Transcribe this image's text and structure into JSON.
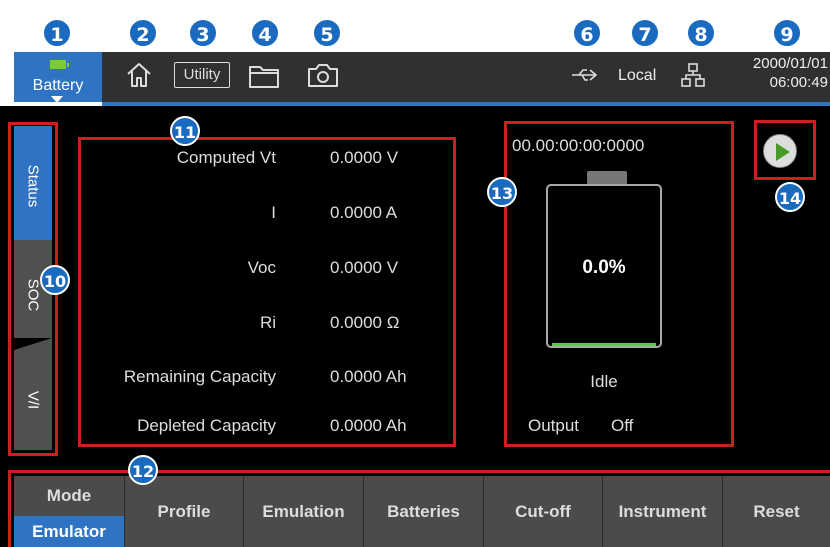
{
  "callouts": [
    "1",
    "2",
    "3",
    "4",
    "5",
    "6",
    "7",
    "8",
    "9",
    "10",
    "11",
    "12",
    "13",
    "14"
  ],
  "topbar": {
    "battery_tab_label": "Battery",
    "utility_label": "Utility",
    "local_label": "Local",
    "date": "2000/01/01",
    "time": "06:00:49",
    "icons": [
      "battery-level-icon",
      "home-icon",
      "folder-icon",
      "camera-icon",
      "usb-icon",
      "network-icon"
    ]
  },
  "sidebar": {
    "tabs": [
      {
        "label": "Status"
      },
      {
        "label": "SOC"
      },
      {
        "label": "V/I"
      }
    ]
  },
  "status": {
    "rows": [
      {
        "label": "Computed Vt",
        "value": "0.0000 V"
      },
      {
        "label": "I",
        "value": "0.0000 A"
      },
      {
        "label": "Voc",
        "value": "0.0000 V"
      },
      {
        "label": "Ri",
        "value": "0.0000 Ω"
      },
      {
        "label": "Remaining Capacity",
        "value": "0.0000 Ah"
      },
      {
        "label": "Depleted Capacity",
        "value": "0.0000 Ah"
      }
    ]
  },
  "battery_widget": {
    "timer": "00.00:00:00:0000",
    "percent": "0.0%",
    "state": "Idle",
    "output_label": "Output",
    "output_value": "Off"
  },
  "softkeys": {
    "mode_label": "Mode",
    "mode_value": "Emulator",
    "keys": [
      "Profile",
      "Emulation",
      "Batteries",
      "Cut-off",
      "Instrument",
      "Reset"
    ]
  },
  "colors": {
    "accent": "#2f73c4",
    "highlight": "#cc1f1f",
    "callout": "#1a6bbf"
  }
}
